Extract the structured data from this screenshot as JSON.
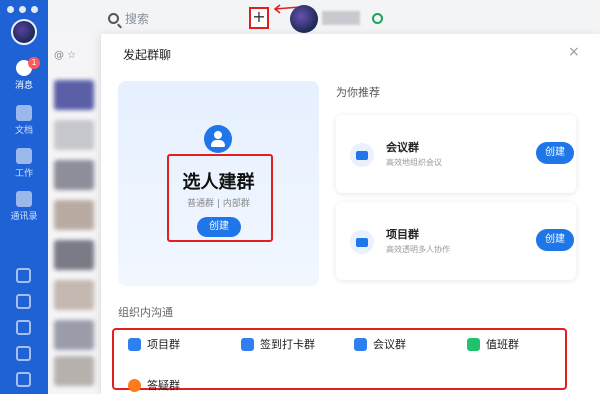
{
  "rail": {
    "items": [
      {
        "label": "消息",
        "badge": "1"
      },
      {
        "label": "文档"
      },
      {
        "label": "工作"
      },
      {
        "label": "通讯录"
      }
    ]
  },
  "topbar": {
    "search_placeholder": "搜索",
    "plus_label": "+"
  },
  "dialog": {
    "title": "发起群聊",
    "close": "×",
    "main_card": {
      "title": "选人建群",
      "subtitle": "普通群 | 内部群",
      "button": "创建"
    },
    "recommend": {
      "title": "为你推荐",
      "items": [
        {
          "name": "会议群",
          "desc": "高效地组织会议",
          "button": "创建"
        },
        {
          "name": "项目群",
          "desc": "高效透明多人协作",
          "button": "创建"
        }
      ]
    },
    "org": {
      "title": "组织内沟通",
      "groups": [
        {
          "name": "项目群",
          "color": "#2f7ff0"
        },
        {
          "name": "签到打卡群",
          "color": "#2f7ff0"
        },
        {
          "name": "会议群",
          "color": "#2f7ff0"
        },
        {
          "name": "值班群",
          "color": "#20c26b"
        },
        {
          "name": "答疑群",
          "color": "#ff7a1a"
        }
      ]
    }
  },
  "colors": {
    "brand": "#1e76e8",
    "rail": "#1f62d6",
    "highlight": "#e21f1f"
  }
}
